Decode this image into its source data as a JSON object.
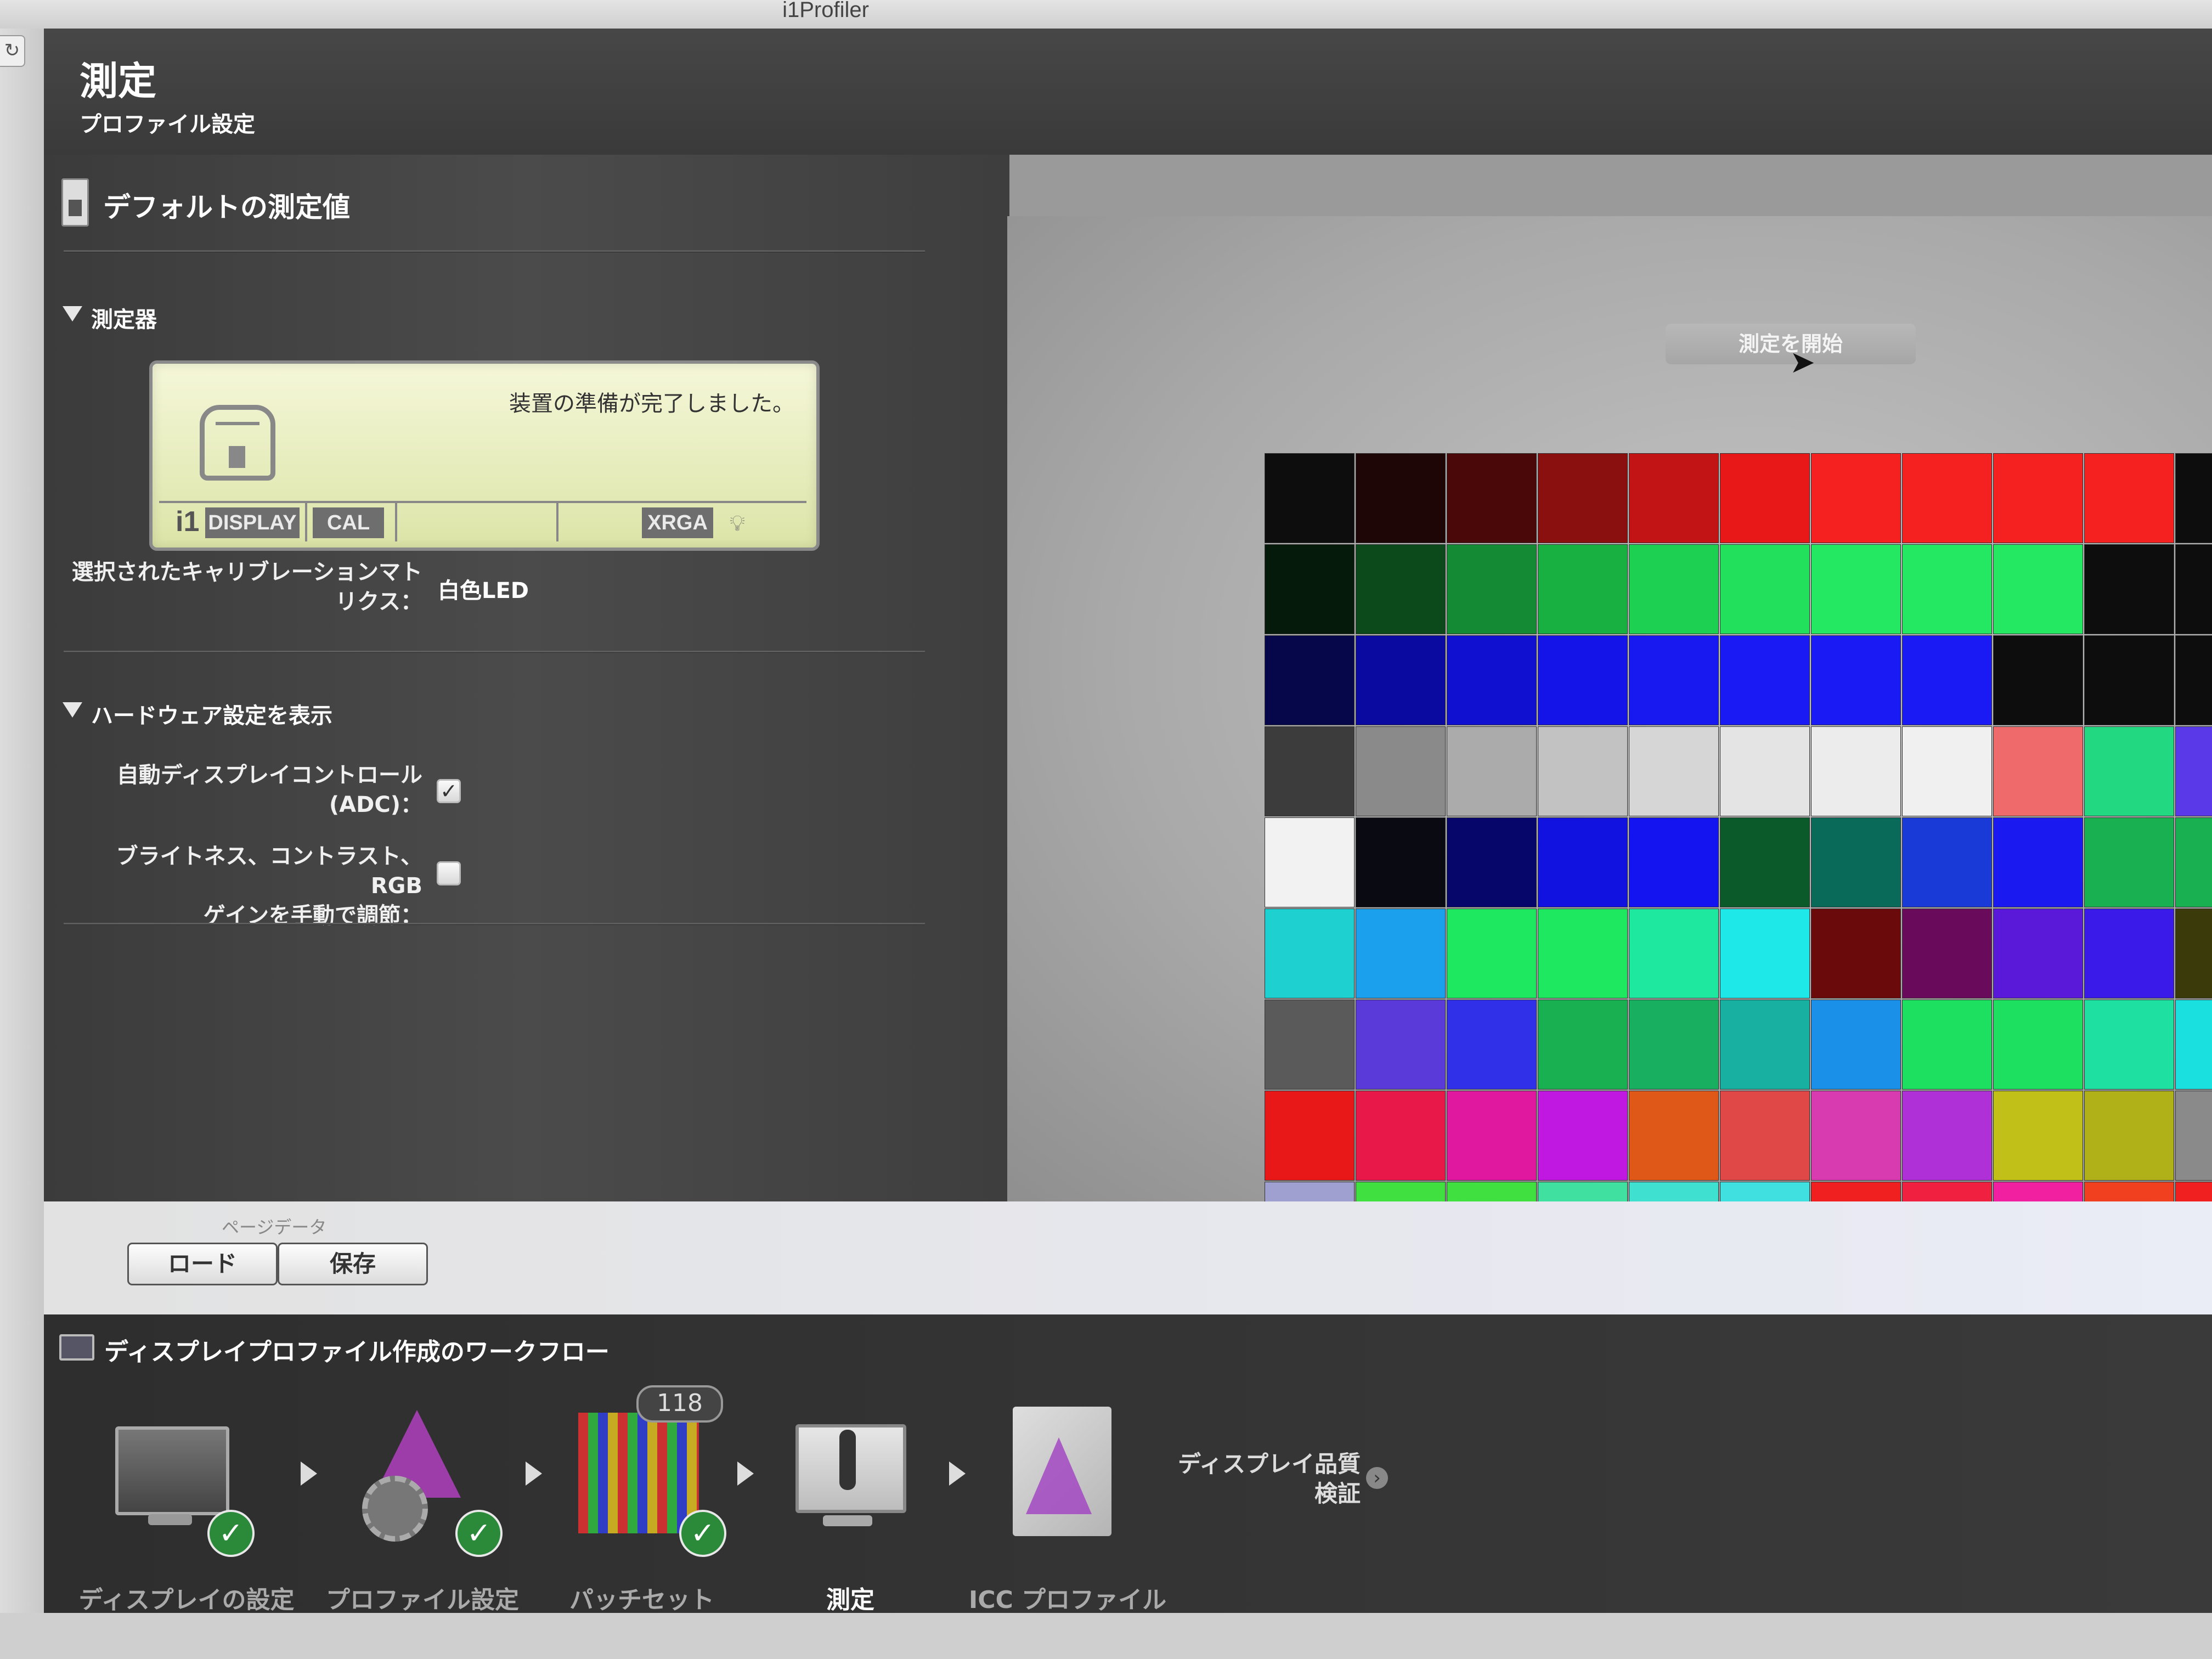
{
  "window": {
    "title": "i1Profiler"
  },
  "header": {
    "title": "測定",
    "subtitle": "プロファイル設定"
  },
  "left_panel": {
    "section_title": "デフォルトの測定値",
    "instrument": {
      "label": "測定器",
      "lcd": {
        "message": "装置の準備が完了しました。",
        "brand": "i1",
        "display_tag": "DISPLAY",
        "cal_tag": "CAL",
        "xrga_tag": "XRGA"
      },
      "calibration_matrix_label_line1": "選択されたキャリブレーションマト",
      "calibration_matrix_label_line2": "リクス：",
      "calibration_matrix_value": "白色LED"
    },
    "hardware": {
      "label": "ハードウェア設定を表示",
      "adc_label_line1": "自動ディスプレイコントロール",
      "adc_label_line2": "(ADC)：",
      "adc_checked": true,
      "manual_label_line1": "ブライトネス、コントラスト、RGB",
      "manual_label_line2": "ゲインを手動で調節：",
      "manual_checked": false
    }
  },
  "preview": {
    "start_button": "測定を開始",
    "patch_rows": [
      [
        "#0d0d0d",
        "#1e0606",
        "#4a0808",
        "#8a1010",
        "#c21414",
        "#e81818",
        "#f52020",
        "#f52020",
        "#f52020",
        "#f52020",
        "#0d0d0d"
      ],
      [
        "#061a0c",
        "#0c4a1c",
        "#148a34",
        "#18b040",
        "#1ed052",
        "#22e05c",
        "#24e862",
        "#24e862",
        "#24e862",
        "#0d0d0d",
        "#0d0d0d"
      ],
      [
        "#06064a",
        "#0a0aa0",
        "#1010d0",
        "#1414e8",
        "#1818f0",
        "#1a1af4",
        "#1a1af4",
        "#1a1af4",
        "#0d0d0d",
        "#0d0d0d",
        "#0d0d0d"
      ],
      [
        "#3c3c3c",
        "#8a8a8a",
        "#ababab",
        "#c2c2c2",
        "#d6d6d6",
        "#e4e4e4",
        "#ececec",
        "#f0f0f0",
        "#ef6a6a",
        "#22d880",
        "#5a3ae8"
      ],
      [
        "#f2f2f2",
        "#0a0a12",
        "#06066a",
        "#1212e0",
        "#1414f0",
        "#0a5a2a",
        "#0a6a5a",
        "#1a3ad8",
        "#1a1af0",
        "#18b050",
        "#18b050"
      ],
      [
        "#1ed0d0",
        "#1aa0ec",
        "#1ee860",
        "#1ee860",
        "#1ee8a0",
        "#1ee8e8",
        "#6a0a0a",
        "#6a0a5a",
        "#5a18d8",
        "#3a1ae8",
        "#3a3a0a"
      ],
      [
        "#5a5a5a",
        "#5a3ad8",
        "#3030e8",
        "#18b050",
        "#18b060",
        "#18b0a0",
        "#1a90e8",
        "#1ee060",
        "#1ee060",
        "#1ee0a0",
        "#1ae0e0"
      ],
      [
        "#e81818",
        "#e81848",
        "#e018a0",
        "#c018e0",
        "#e05818",
        "#e04848",
        "#d83ab0",
        "#b030d8",
        "#c0c018",
        "#b0b018",
        "#8a8a8a"
      ],
      [
        "#a0a0d0",
        "#40e040",
        "#40e040",
        "#40e0a0",
        "#40e0d0",
        "#40e0e0",
        "#f02020",
        "#f02040",
        "#f020a0",
        "#f04020",
        "#f02020"
      ]
    ]
  },
  "bottom_bar": {
    "page_data_label": "ページデータ",
    "load_button": "ロード",
    "save_button": "保存"
  },
  "workflow": {
    "title": "ディスプレイプロファイル作成のワークフロー",
    "steps": [
      {
        "label": "ディスプレイの設定",
        "done": true
      },
      {
        "label": "プロファイル設定",
        "done": true
      },
      {
        "label": "パッチセット",
        "done": true,
        "count": "118"
      },
      {
        "label": "測定",
        "done": false,
        "active": true
      },
      {
        "label": "ICC プロファイル",
        "done": false
      }
    ],
    "verify_line1": "ディスプレイ品質",
    "verify_line2": "検証"
  },
  "icons": [
    "refresh-icon",
    "document-icon",
    "disclosure-triangle-icon",
    "device-icon",
    "light-bulb-icon",
    "cursor-arrow-icon",
    "monitor-icon",
    "checkmark-icon",
    "arrow-right-icon",
    "color-gamut-icon",
    "settings-gear-icon",
    "patch-grid-icon",
    "icc-file-icon",
    "info-circle-icon"
  ]
}
